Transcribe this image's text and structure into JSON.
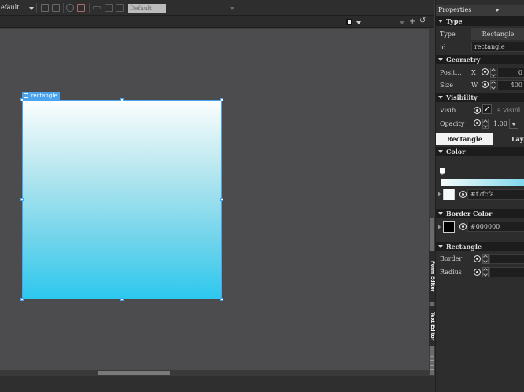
{
  "toolbar": {
    "style_combo": "efault",
    "state_combo": "Default"
  },
  "canvas": {
    "selected_label": "rectangle",
    "colors": {
      "background": "#4c4c4f",
      "selection": "#4aa3ef",
      "gradient_top": "#fbfdfd",
      "gradient_bottom": "#2dc8ee"
    }
  },
  "side_tabs": {
    "form_editor": "Form Editor",
    "text_editor": "Text Editor"
  },
  "properties": {
    "title": "Properties",
    "type_section": {
      "title": "Type",
      "type_label": "Type",
      "type_value": "Rectangle",
      "id_label": "id",
      "id_value": "rectangle"
    },
    "geometry": {
      "title": "Geometry",
      "position_label": "Posit…",
      "x_label": "X",
      "x_value": "0",
      "size_label": "Size",
      "w_label": "W",
      "w_value": "400"
    },
    "visibility": {
      "title": "Visibility",
      "visible_label": "Visib…",
      "visible_checkbox_text": "Is Visibl",
      "opacity_label": "Opacity",
      "opacity_value": "1.00"
    },
    "tabs": {
      "rectangle": "Rectangle",
      "layout": "Layo"
    },
    "color": {
      "title": "Color",
      "value": "#f7fcfa"
    },
    "border_color": {
      "title": "Border Color",
      "value": "#000000"
    },
    "rectangle": {
      "title": "Rectangle",
      "border_label": "Border",
      "radius_label": "Radius"
    }
  }
}
